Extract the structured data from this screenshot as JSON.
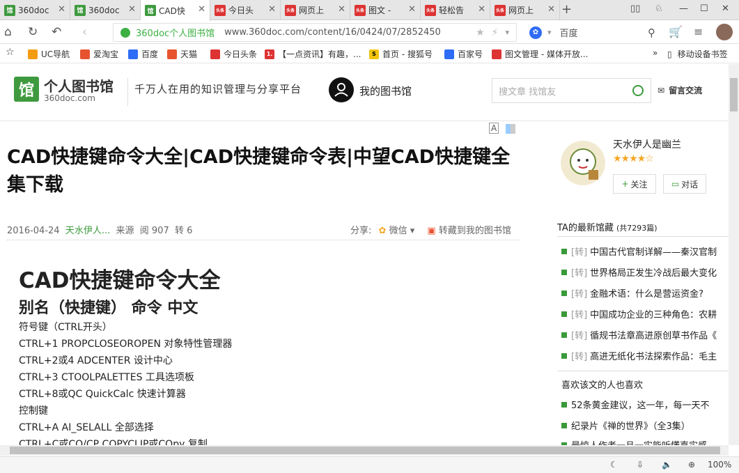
{
  "tabs": [
    {
      "favicon": "馆",
      "favicon_color": "#3f9a3f",
      "title": "360doc"
    },
    {
      "favicon": "馆",
      "favicon_color": "#3f9a3f",
      "title": "360doc"
    },
    {
      "favicon": "馆",
      "favicon_color": "#3f9a3f",
      "title": "CAD快"
    },
    {
      "favicon": "头条",
      "favicon_color": "#d33",
      "title": "今日头"
    },
    {
      "favicon": "头条",
      "favicon_color": "#d33",
      "title": "网页上"
    },
    {
      "favicon": "头条",
      "favicon_color": "#d33",
      "title": "图文 -"
    },
    {
      "favicon": "头条",
      "favicon_color": "#d33",
      "title": "轻松告"
    },
    {
      "favicon": "头条",
      "favicon_color": "#d33",
      "title": "网页上"
    }
  ],
  "address": {
    "site_name": "360doc个人图书馆",
    "url": "www.360doc.com/content/16/0424/07/2852450",
    "search_engine": "百度"
  },
  "bookmarks": [
    {
      "label": "UC导航",
      "color": "#f39c12"
    },
    {
      "label": "爱淘宝",
      "color": "#e8532f"
    },
    {
      "label": "百度",
      "color": "#2f6cf6"
    },
    {
      "label": "天猫",
      "color": "#e8532f"
    },
    {
      "label": "今日头条",
      "color": "#d33"
    },
    {
      "label": "【一点资讯】有趣，...",
      "color": "#d33"
    },
    {
      "label": "首页 - 搜狐号",
      "color": "#f1c40f"
    },
    {
      "label": "百家号",
      "color": "#2f6cf6"
    },
    {
      "label": "图文管理 - 媒体开放...",
      "color": "#d33"
    }
  ],
  "bookmarks_more": "»",
  "mobile_bookmarks": "移动设备书签",
  "header": {
    "logo_glyph": "馆",
    "logo_title": "个人图书馆",
    "logo_domain": "360doc.com",
    "slogan": "千万人在用的知识管理与分享平台",
    "my_library": "我的图书馆",
    "search_placeholder": "搜文章 找馆友",
    "message": "留言交流"
  },
  "article": {
    "title": "CAD快捷键命令大全|CAD快捷键命令表|中望CAD快捷键全集下载",
    "date": "2016-04-24",
    "author": "天水伊人...",
    "source": "来源",
    "reads": "阅 907",
    "reposts": "转 6",
    "share_label": "分享:",
    "wechat": "微信",
    "save": "转藏到我的图书馆",
    "h1": "CAD快捷键命令大全",
    "h2": "别名（快捷键） 命令 中文",
    "lines": [
      "符号键（CTRL开头）",
      "CTRL+1 PROPCLOSEOROPEN 对象特性管理器",
      "CTRL+2或4 ADCENTER 设计中心",
      "CTRL+3 CTOOLPALETTES 工具选项板",
      "CTRL+8或QC QuickCalc 快速计算器",
      "控制键",
      "CTRL+A AI_SELALL 全部选择",
      "CTRL+C或CO/CP COPYCLIP或COpy 复制"
    ]
  },
  "sidebar": {
    "username": "天水伊人是幽兰",
    "stars": "★★★★☆",
    "follow": "关注",
    "chat": "对话",
    "latest_title": "TA的最新馆藏",
    "latest_count": "(共7293篇)",
    "latest": [
      "中国古代官制详解——秦汉官制",
      "世界格局正发生冷战后最大变化",
      "金融术语：什么是营运资金?",
      "中国成功企业的三种角色：农耕",
      "循规书法章高进原创草书作品《",
      "高进无纸化书法探索作品：毛主"
    ],
    "liked_title": "喜欢该文的人也喜欢",
    "liked": [
      "52条黄金建议，这一年，每一天不",
      "纪录片《禅的世界》（全3集）",
      "最惊人作者一旦一实能听懂直实感"
    ],
    "repost_tag": "[转]"
  },
  "status": {
    "zoom": "100%"
  }
}
